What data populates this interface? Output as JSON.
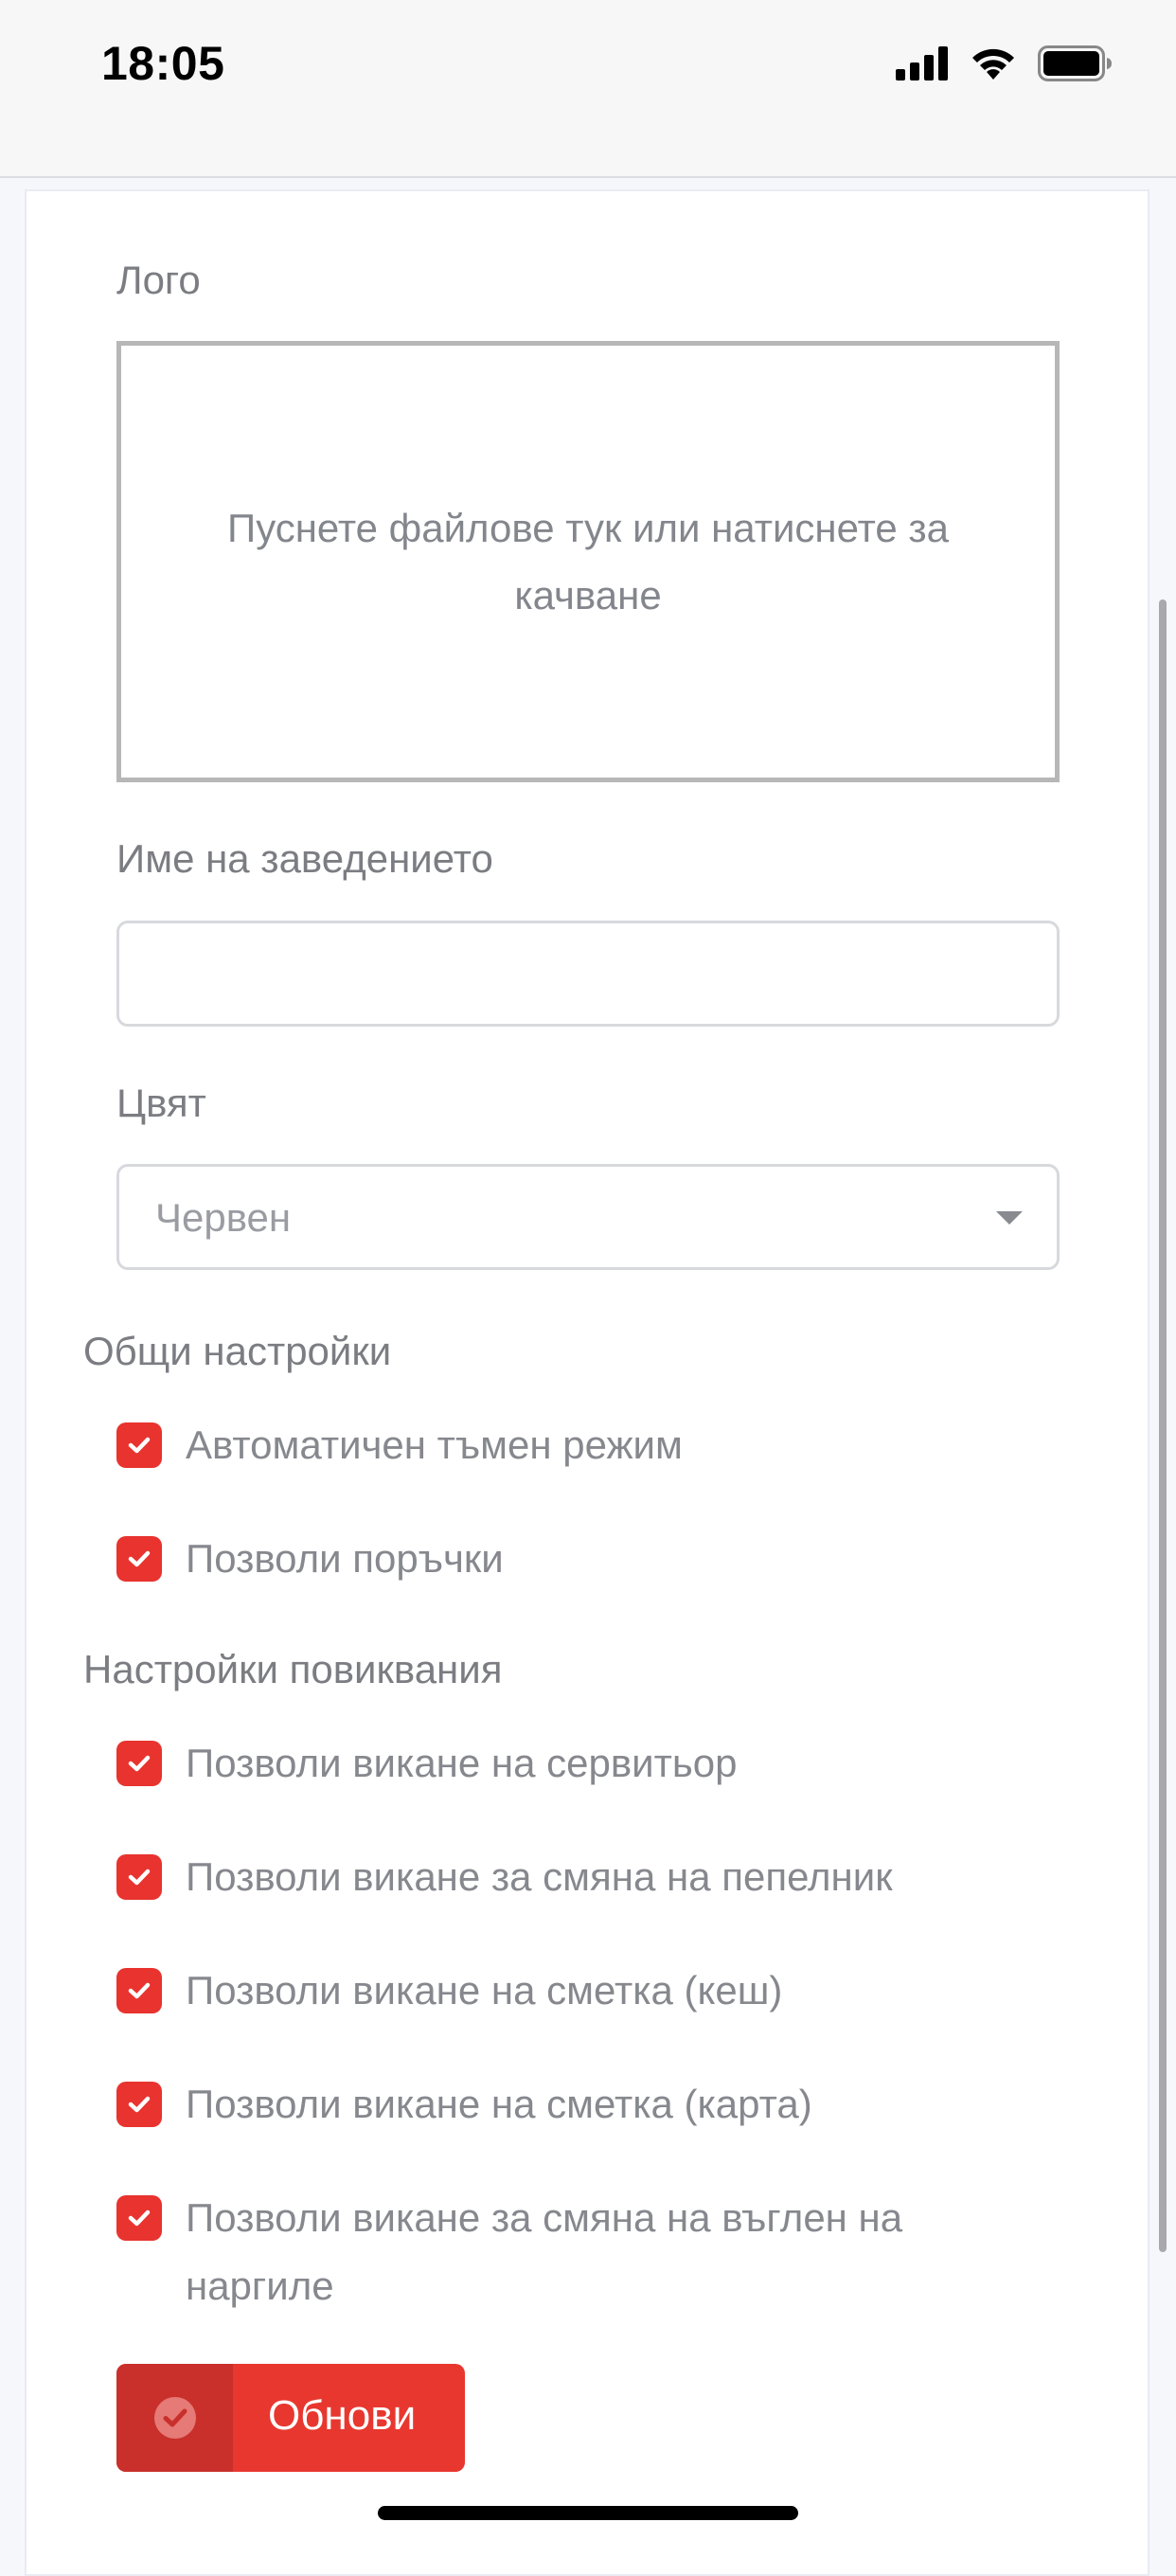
{
  "status_bar": {
    "time": "18:05",
    "icons": [
      "cellular-signal-icon",
      "wifi-icon",
      "battery-icon"
    ]
  },
  "form": {
    "logo_label": "Лого",
    "dropzone_text": "Пуснете файлове тук или натиснете за качване",
    "name_label": "Име на заведението",
    "name_value": "",
    "color_label": "Цвят",
    "color_selected": "Червен"
  },
  "general_settings": {
    "title": "Общи настройки",
    "items": [
      {
        "label": "Автоматичен тъмен режим",
        "checked": true
      },
      {
        "label": "Позволи поръчки",
        "checked": true
      }
    ]
  },
  "call_settings": {
    "title": "Настройки повиквания",
    "items": [
      {
        "label": "Позволи викане на сервитьор",
        "checked": true
      },
      {
        "label": "Позволи викане за смяна на пепелник",
        "checked": true
      },
      {
        "label": "Позволи викане на сметка (кеш)",
        "checked": true
      },
      {
        "label": "Позволи викане на сметка (карта)",
        "checked": true
      },
      {
        "label": "Позволи викане за смяна на въглен на наргиле",
        "checked": true
      }
    ]
  },
  "actions": {
    "update_label": "Обнови",
    "update_icon": "check-circle-icon"
  },
  "colors": {
    "accent": "#e8332f",
    "accent_dark": "#c9302b",
    "text_muted": "#7b7d82",
    "border": "#d7d9dd"
  }
}
